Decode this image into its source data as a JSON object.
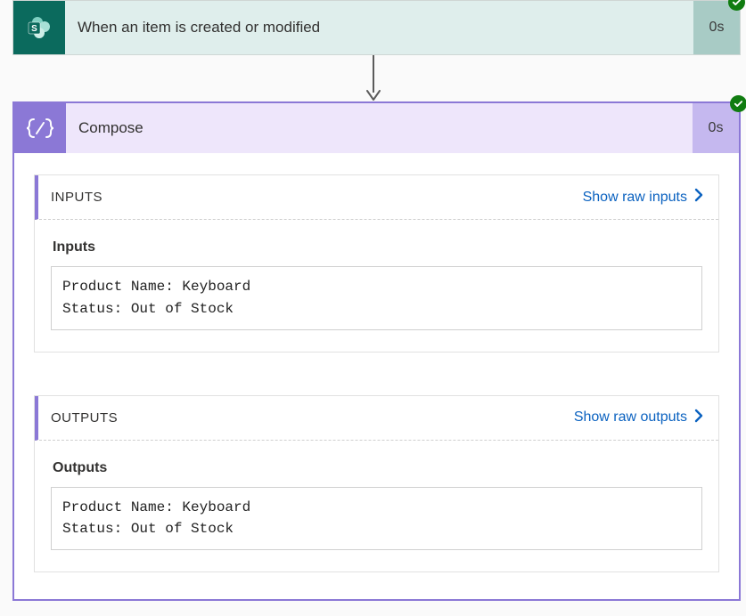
{
  "trigger": {
    "title": "When an item is created or modified",
    "duration": "0s"
  },
  "compose": {
    "title": "Compose",
    "duration": "0s",
    "inputs_section_label": "INPUTS",
    "show_raw_inputs_label": "Show raw inputs",
    "inputs_sub_label": "Inputs",
    "inputs_value": "Product Name: Keyboard\nStatus: Out of Stock",
    "outputs_section_label": "OUTPUTS",
    "show_raw_outputs_label": "Show raw outputs",
    "outputs_sub_label": "Outputs",
    "outputs_value": "Product Name: Keyboard\nStatus: Out of Stock"
  }
}
